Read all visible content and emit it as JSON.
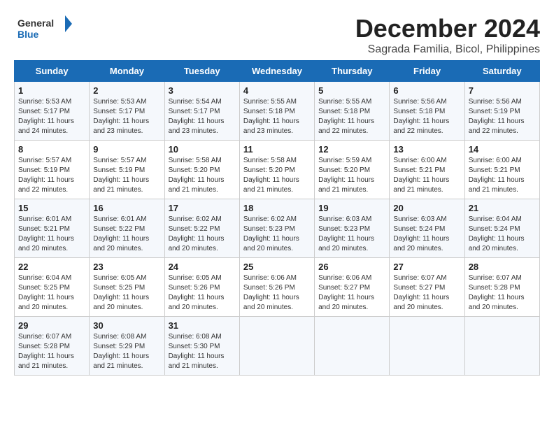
{
  "logo": {
    "general": "General",
    "blue": "Blue"
  },
  "title": "December 2024",
  "location": "Sagrada Familia, Bicol, Philippines",
  "days_of_week": [
    "Sunday",
    "Monday",
    "Tuesday",
    "Wednesday",
    "Thursday",
    "Friday",
    "Saturday"
  ],
  "weeks": [
    [
      {
        "day": "1",
        "sunrise": "5:53 AM",
        "sunset": "5:17 PM",
        "daylight": "11 hours and 24 minutes."
      },
      {
        "day": "2",
        "sunrise": "5:53 AM",
        "sunset": "5:17 PM",
        "daylight": "11 hours and 23 minutes."
      },
      {
        "day": "3",
        "sunrise": "5:54 AM",
        "sunset": "5:17 PM",
        "daylight": "11 hours and 23 minutes."
      },
      {
        "day": "4",
        "sunrise": "5:55 AM",
        "sunset": "5:18 PM",
        "daylight": "11 hours and 23 minutes."
      },
      {
        "day": "5",
        "sunrise": "5:55 AM",
        "sunset": "5:18 PM",
        "daylight": "11 hours and 22 minutes."
      },
      {
        "day": "6",
        "sunrise": "5:56 AM",
        "sunset": "5:18 PM",
        "daylight": "11 hours and 22 minutes."
      },
      {
        "day": "7",
        "sunrise": "5:56 AM",
        "sunset": "5:19 PM",
        "daylight": "11 hours and 22 minutes."
      }
    ],
    [
      {
        "day": "8",
        "sunrise": "5:57 AM",
        "sunset": "5:19 PM",
        "daylight": "11 hours and 22 minutes."
      },
      {
        "day": "9",
        "sunrise": "5:57 AM",
        "sunset": "5:19 PM",
        "daylight": "11 hours and 21 minutes."
      },
      {
        "day": "10",
        "sunrise": "5:58 AM",
        "sunset": "5:20 PM",
        "daylight": "11 hours and 21 minutes."
      },
      {
        "day": "11",
        "sunrise": "5:58 AM",
        "sunset": "5:20 PM",
        "daylight": "11 hours and 21 minutes."
      },
      {
        "day": "12",
        "sunrise": "5:59 AM",
        "sunset": "5:20 PM",
        "daylight": "11 hours and 21 minutes."
      },
      {
        "day": "13",
        "sunrise": "6:00 AM",
        "sunset": "5:21 PM",
        "daylight": "11 hours and 21 minutes."
      },
      {
        "day": "14",
        "sunrise": "6:00 AM",
        "sunset": "5:21 PM",
        "daylight": "11 hours and 21 minutes."
      }
    ],
    [
      {
        "day": "15",
        "sunrise": "6:01 AM",
        "sunset": "5:21 PM",
        "daylight": "11 hours and 20 minutes."
      },
      {
        "day": "16",
        "sunrise": "6:01 AM",
        "sunset": "5:22 PM",
        "daylight": "11 hours and 20 minutes."
      },
      {
        "day": "17",
        "sunrise": "6:02 AM",
        "sunset": "5:22 PM",
        "daylight": "11 hours and 20 minutes."
      },
      {
        "day": "18",
        "sunrise": "6:02 AM",
        "sunset": "5:23 PM",
        "daylight": "11 hours and 20 minutes."
      },
      {
        "day": "19",
        "sunrise": "6:03 AM",
        "sunset": "5:23 PM",
        "daylight": "11 hours and 20 minutes."
      },
      {
        "day": "20",
        "sunrise": "6:03 AM",
        "sunset": "5:24 PM",
        "daylight": "11 hours and 20 minutes."
      },
      {
        "day": "21",
        "sunrise": "6:04 AM",
        "sunset": "5:24 PM",
        "daylight": "11 hours and 20 minutes."
      }
    ],
    [
      {
        "day": "22",
        "sunrise": "6:04 AM",
        "sunset": "5:25 PM",
        "daylight": "11 hours and 20 minutes."
      },
      {
        "day": "23",
        "sunrise": "6:05 AM",
        "sunset": "5:25 PM",
        "daylight": "11 hours and 20 minutes."
      },
      {
        "day": "24",
        "sunrise": "6:05 AM",
        "sunset": "5:26 PM",
        "daylight": "11 hours and 20 minutes."
      },
      {
        "day": "25",
        "sunrise": "6:06 AM",
        "sunset": "5:26 PM",
        "daylight": "11 hours and 20 minutes."
      },
      {
        "day": "26",
        "sunrise": "6:06 AM",
        "sunset": "5:27 PM",
        "daylight": "11 hours and 20 minutes."
      },
      {
        "day": "27",
        "sunrise": "6:07 AM",
        "sunset": "5:27 PM",
        "daylight": "11 hours and 20 minutes."
      },
      {
        "day": "28",
        "sunrise": "6:07 AM",
        "sunset": "5:28 PM",
        "daylight": "11 hours and 20 minutes."
      }
    ],
    [
      {
        "day": "29",
        "sunrise": "6:07 AM",
        "sunset": "5:28 PM",
        "daylight": "11 hours and 21 minutes."
      },
      {
        "day": "30",
        "sunrise": "6:08 AM",
        "sunset": "5:29 PM",
        "daylight": "11 hours and 21 minutes."
      },
      {
        "day": "31",
        "sunrise": "6:08 AM",
        "sunset": "5:30 PM",
        "daylight": "11 hours and 21 minutes."
      },
      null,
      null,
      null,
      null
    ]
  ]
}
